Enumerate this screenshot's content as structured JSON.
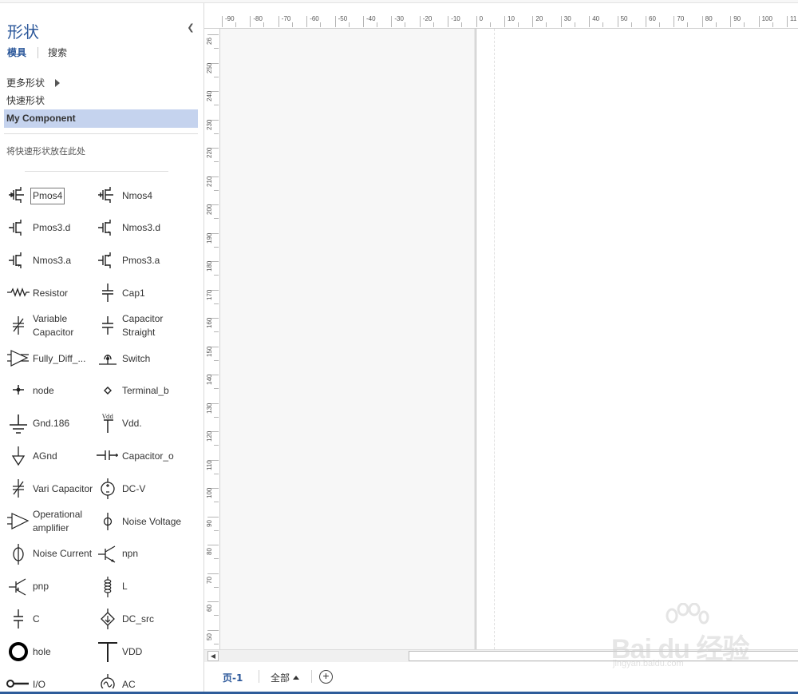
{
  "sidebar": {
    "title": "形状",
    "tabs": [
      {
        "label": "模具"
      },
      {
        "label": "搜索"
      }
    ],
    "more_shapes": "更多形状",
    "quick_shapes": "快速形状",
    "selected_stencil": "My Component",
    "drop_hint": "将快速形状放在此处",
    "shapes": [
      {
        "label": "Pmos4",
        "icon": "pmos4-icon"
      },
      {
        "label": "Nmos4",
        "icon": "nmos4-icon"
      },
      {
        "label": "Pmos3.d",
        "icon": "pmos3d-icon"
      },
      {
        "label": "Nmos3.d",
        "icon": "nmos3d-icon"
      },
      {
        "label": "Nmos3.a",
        "icon": "nmos3a-icon"
      },
      {
        "label": "Pmos3.a",
        "icon": "pmos3a-icon"
      },
      {
        "label": "Resistor",
        "icon": "resistor-icon"
      },
      {
        "label": "Cap1",
        "icon": "capacitor-icon"
      },
      {
        "label": "Variable Capacitor",
        "icon": "variable-capacitor-icon"
      },
      {
        "label": "Capacitor Straight",
        "icon": "capacitor-straight-icon"
      },
      {
        "label": "Fully_Diff_...",
        "icon": "fully-diff-amplifier-icon"
      },
      {
        "label": "Switch",
        "icon": "switch-icon"
      },
      {
        "label": "node",
        "icon": "node-icon"
      },
      {
        "label": "Terminal_b",
        "icon": "terminal-icon"
      },
      {
        "label": "Gnd.186",
        "icon": "ground-icon"
      },
      {
        "label": "Vdd.",
        "icon": "vdd-icon"
      },
      {
        "label": "AGnd",
        "icon": "analog-ground-icon"
      },
      {
        "label": "Capacitor_o",
        "icon": "capacitor-o-icon"
      },
      {
        "label": "Vari Capacitor",
        "icon": "vari-capacitor-icon"
      },
      {
        "label": "DC-V",
        "icon": "dc-voltage-source-icon"
      },
      {
        "label": "Operational amplifier",
        "icon": "op-amp-icon"
      },
      {
        "label": "Noise Voltage",
        "icon": "noise-voltage-icon"
      },
      {
        "label": "Noise Current",
        "icon": "noise-current-icon"
      },
      {
        "label": "npn",
        "icon": "npn-transistor-icon"
      },
      {
        "label": "pnp",
        "icon": "pnp-transistor-icon"
      },
      {
        "label": "L",
        "icon": "inductor-icon"
      },
      {
        "label": "C",
        "icon": "capacitor-c-icon"
      },
      {
        "label": "DC_src",
        "icon": "dc-current-source-icon"
      },
      {
        "label": "hole",
        "icon": "hole-icon"
      },
      {
        "label": "VDD",
        "icon": "vdd-t-icon"
      },
      {
        "label": "I/O",
        "icon": "io-pin-icon"
      },
      {
        "label": "AC",
        "icon": "ac-source-icon"
      }
    ]
  },
  "ruler": {
    "top_labels": [
      "-90",
      "-80",
      "-70",
      "-60",
      "-50",
      "-40",
      "-30",
      "-20",
      "-10",
      "0",
      "10",
      "20",
      "30",
      "40",
      "50",
      "60",
      "70",
      "80",
      "90",
      "100",
      "11"
    ],
    "left_labels": [
      "26",
      "250",
      "240",
      "230",
      "220",
      "210",
      "200",
      "190",
      "180",
      "170",
      "160",
      "150",
      "140",
      "130",
      "120",
      "110",
      "100",
      "90",
      "80",
      "70",
      "60",
      "50"
    ]
  },
  "pagebar": {
    "page_tab": "页-1",
    "all_tab": "全部",
    "add_page": "+"
  },
  "watermark": {
    "text": "Bai du 经验",
    "sub": "jingyan.baidu.com"
  }
}
